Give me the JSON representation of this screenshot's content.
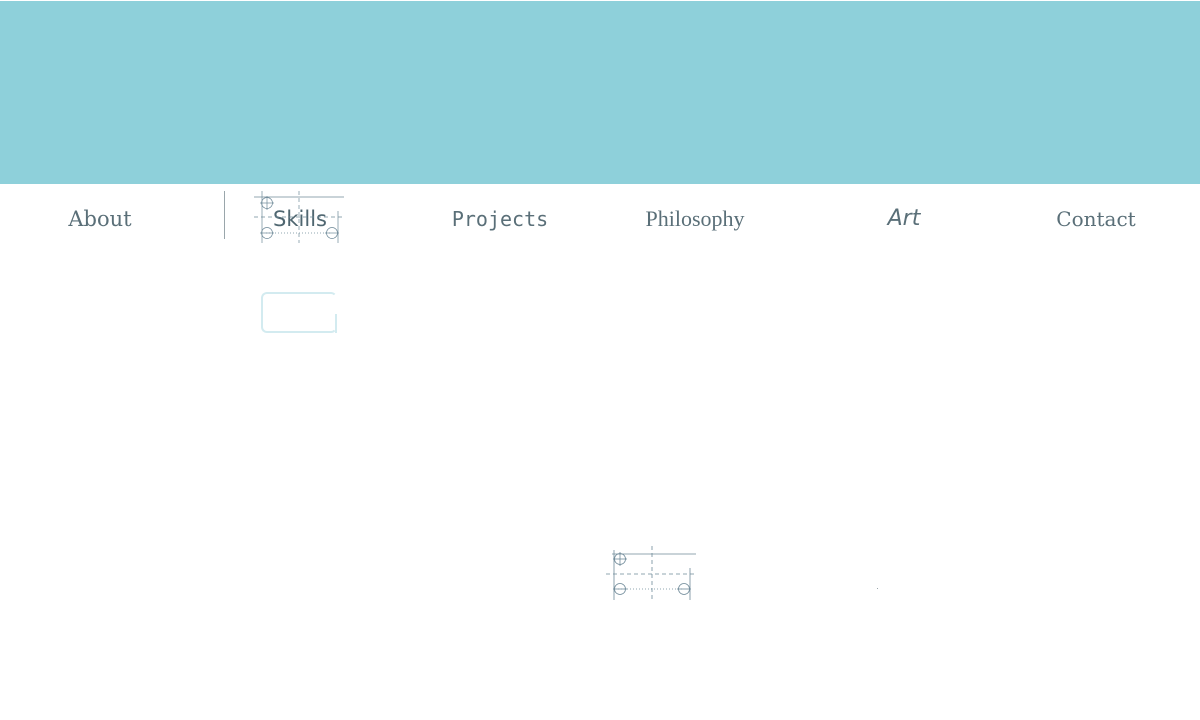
{
  "hero": {
    "color": "#8ed0da"
  },
  "nav": {
    "items": [
      {
        "label": "About"
      },
      {
        "label": "Skills",
        "active": true
      },
      {
        "label": "Projects"
      },
      {
        "label": "Philosophy"
      },
      {
        "label": "Art"
      },
      {
        "label": "Contact"
      }
    ],
    "text_color": "#5a6f78"
  },
  "decor": {
    "active_outline_color": "#d3ebf0",
    "blueprint_line_color": "#6f8a99"
  }
}
